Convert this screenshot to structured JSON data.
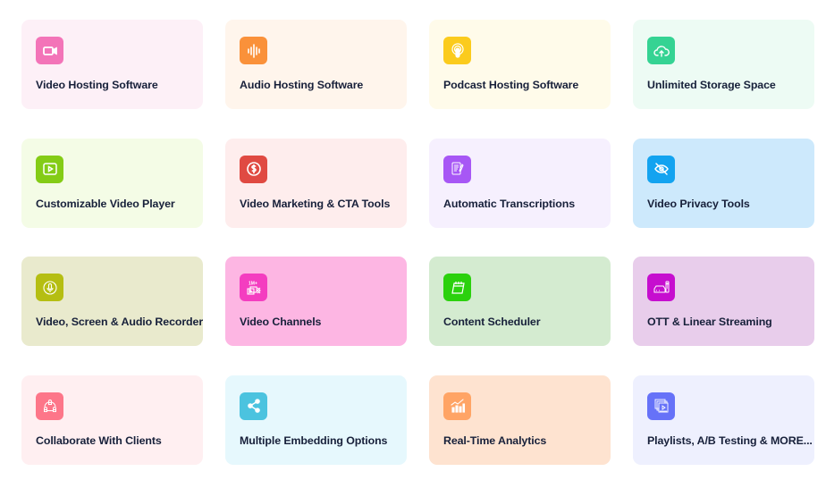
{
  "features": [
    {
      "label": "Video Hosting Software",
      "icon": "video-camera-icon",
      "bg": "#fdf0f7",
      "accent": "#f374b8"
    },
    {
      "label": "Audio Hosting Software",
      "icon": "audio-waveform-icon",
      "bg": "#fff5ec",
      "accent": "#fa913a"
    },
    {
      "label": "Podcast Hosting Software",
      "icon": "podcast-icon",
      "bg": "#fffbea",
      "accent": "#fbcb1d"
    },
    {
      "label": "Unlimited Storage Space",
      "icon": "cloud-upload-icon",
      "bg": "#edfbf4",
      "accent": "#35d393"
    },
    {
      "label": "Customizable Video Player",
      "icon": "video-player-icon",
      "bg": "#f4fce6",
      "accent": "#84cc16"
    },
    {
      "label": "Video Marketing & CTA Tools",
      "icon": "dollar-icon",
      "bg": "#feeded",
      "accent": "#e04a42"
    },
    {
      "label": "Automatic Transcriptions",
      "icon": "transcript-icon",
      "bg": "#f6f0fe",
      "accent": "#a757f5"
    },
    {
      "label": "Video Privacy Tools",
      "icon": "eye-off-icon",
      "bg": "#cde9fc",
      "accent": "#13a3f0"
    },
    {
      "label": "Video, Screen & Audio Recorder",
      "icon": "microphone-icon",
      "bg": "#e9eacd",
      "accent": "#b5be12"
    },
    {
      "label": "Video Channels",
      "icon": "channels-icon",
      "bg": "#fdb6e3",
      "accent": "#f43dc0"
    },
    {
      "label": "Content Scheduler",
      "icon": "calendar-icon",
      "bg": "#d4ebd0",
      "accent": "#2bd10d"
    },
    {
      "label": "OTT & Linear Streaming",
      "icon": "set-top-box-icon",
      "bg": "#e8cdeb",
      "accent": "#c60ecf"
    },
    {
      "label": "Collaborate With Clients",
      "icon": "collaboration-icon",
      "bg": "#ffeff1",
      "accent": "#fd7689"
    },
    {
      "label": "Multiple Embedding Options",
      "icon": "share-icon",
      "bg": "#e6f8fd",
      "accent": "#4bc3df"
    },
    {
      "label": "Real-Time Analytics",
      "icon": "analytics-icon",
      "bg": "#fee3d0",
      "accent": "#ffa465"
    },
    {
      "label": "Playlists, A/B Testing & MORE...",
      "icon": "playlist-icon",
      "bg": "#eef0fe",
      "accent": "#6672f8"
    }
  ]
}
